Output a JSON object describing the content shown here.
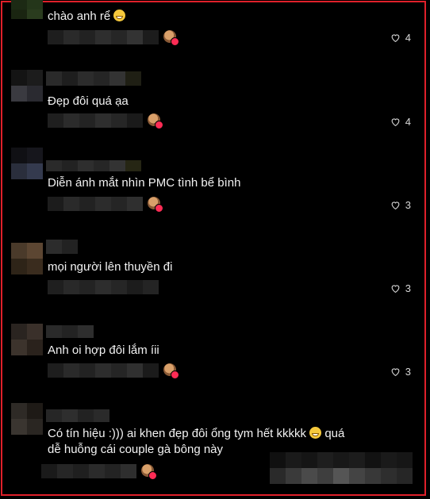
{
  "comments": [
    {
      "text": "chào anh rể",
      "emoji": "grinning-emoji",
      "likes": "4"
    },
    {
      "text": "Đẹp đôi quá ạa",
      "likes": "4"
    },
    {
      "text": "Diễn ánh mắt nhìn PMC tình bể bình",
      "likes": "3"
    },
    {
      "text": "mọi người lên thuyền đi",
      "likes": "3"
    },
    {
      "text": "Anh oi hợp đôi lắm íii",
      "likes": "3"
    },
    {
      "text_part1": "Có tín hiệu :))) ai khen đẹp đôi ổng tym hết kkkkk",
      "emoji": "laughing-emoji",
      "text_part2": "quá",
      "text_line2": "dễ huỗng cái couple gà bông này"
    }
  ],
  "colors": {
    "frame": "#e0202a",
    "background": "#000000",
    "badge": "#fe2c55"
  }
}
